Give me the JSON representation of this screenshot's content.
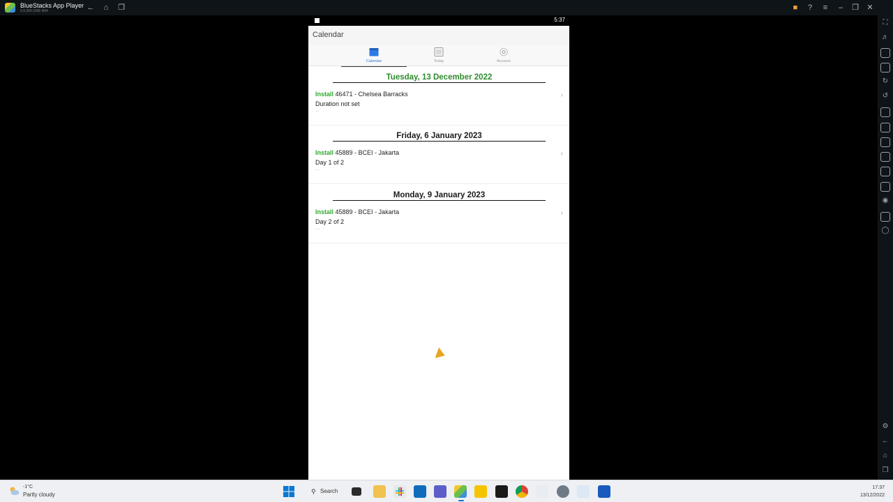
{
  "window": {
    "title": "BlueStacks App Player",
    "version": "5.9.350.1035 N64"
  },
  "statusbar": {
    "time": "5:37"
  },
  "app": {
    "title": "Calendar",
    "tabs": [
      {
        "label": "Calendar",
        "icon": "calendar-icon",
        "active": true
      },
      {
        "label": "Today",
        "icon": "today-icon",
        "active": false
      },
      {
        "label": "Account",
        "icon": "gear-icon",
        "active": false
      }
    ],
    "entries": [
      {
        "date": "Tuesday, 13 December 2022",
        "type": "Install",
        "job": "46471 - Chelsea Barracks",
        "detail": "Duration not set",
        "more": "..."
      },
      {
        "date": "Friday, 6 January 2023",
        "type": "Install",
        "job": "45889 - BCEI - Jakarta",
        "detail": "Day 1 of 2",
        "more": "..."
      },
      {
        "date": "Monday, 9 January 2023",
        "type": "Install",
        "job": "45889 - BCEI - Jakarta",
        "detail": "Day 2 of 2",
        "more": "..."
      }
    ]
  },
  "taskbar": {
    "weather_temp": "-1°C",
    "weather_condition": "Partly cloudy",
    "search_label": "Search",
    "clock_time": "17:37",
    "clock_date": "13/12/2022"
  },
  "colors": {
    "accent_green": "#2eaa2e",
    "today_date_green": "#2e8b2e",
    "tab_active_blue": "#2c7be5"
  }
}
